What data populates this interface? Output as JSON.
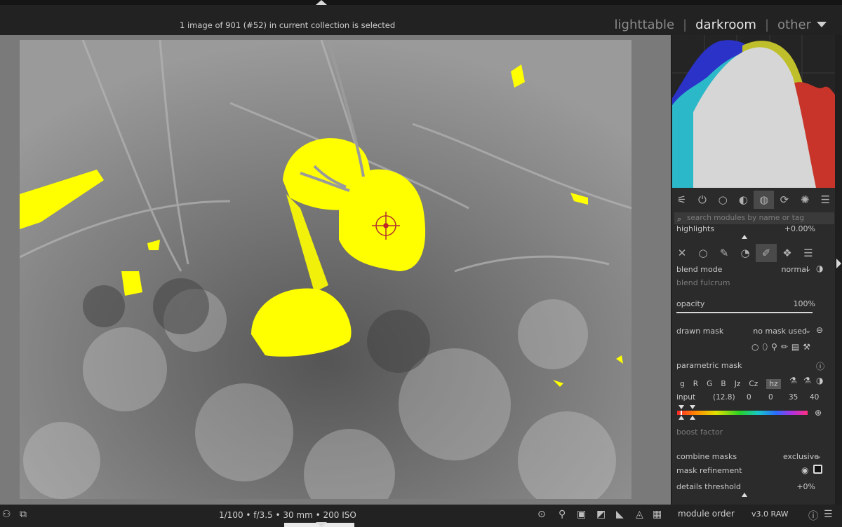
{
  "header": {
    "collection_info": "1 image of 901 (#52) in current collection is selected",
    "views": [
      "lighttable",
      "darkroom",
      "other"
    ],
    "active_view": "darkroom",
    "separator": "|"
  },
  "histogram": {
    "colors": {
      "red": "#c8342a",
      "green": "#bfbf2b",
      "blue": "#2b32c8",
      "cyan": "#2bb8c8",
      "gray": "#d6d6d6"
    }
  },
  "module_tabs": [
    "presets-icon",
    "power-icon",
    "circle-icon",
    "tone-icon",
    "color-balance-icon",
    "refresh-icon",
    "favorite-icon",
    "menu-icon"
  ],
  "search": {
    "placeholder": "search modules by name or tag"
  },
  "highlights": {
    "label": "highlights",
    "value": "+0.00%"
  },
  "blend_tabs": [
    "off-icon",
    "uniform-icon",
    "drawn-icon",
    "parametric-icon",
    "drawn-parametric-icon",
    "raster-icon",
    "menu-icon"
  ],
  "blend_mode": {
    "label": "blend mode",
    "value": "normal"
  },
  "blend_fulcrum": {
    "label": "blend fulcrum"
  },
  "opacity": {
    "label": "opacity",
    "value": "100%",
    "level": 1.0
  },
  "drawn_mask": {
    "label": "drawn mask",
    "value": "no mask used"
  },
  "parametric_mask": {
    "label": "parametric mask"
  },
  "channels": [
    "g",
    "R",
    "G",
    "B",
    "Jz",
    "Cz",
    "hz"
  ],
  "selected_channel": "hz",
  "input": {
    "label": "input",
    "values": [
      "(12.8)",
      "0",
      "0",
      "35",
      "40"
    ]
  },
  "boost_factor": {
    "label": "boost factor"
  },
  "combine_masks": {
    "label": "combine masks",
    "value": "exclusive"
  },
  "mask_refinement": {
    "label": "mask refinement"
  },
  "details_threshold": {
    "label": "details threshold",
    "value": "+0%"
  },
  "footer": {
    "exif": "1/100 • f/3.5 • 30 mm • 200 ISO",
    "module_order_label": "module order",
    "module_order_value": "v3.0 RAW"
  },
  "mask_color": "#ffff00"
}
